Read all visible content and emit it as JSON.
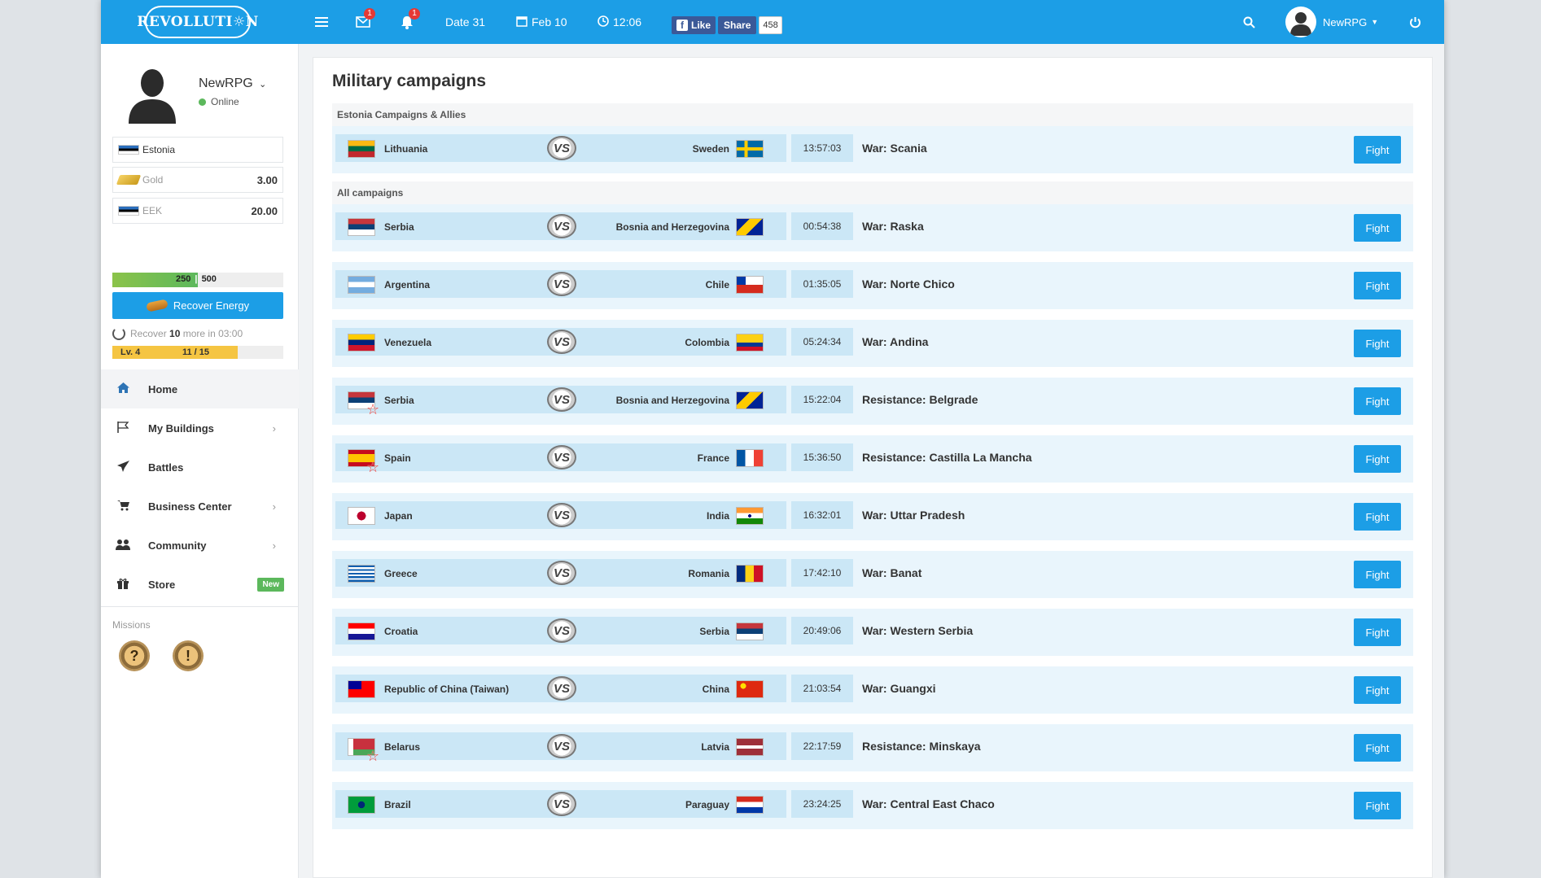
{
  "topbar": {
    "logo": "REVOLLUTI☼N",
    "mail_badge": "1",
    "notif_badge": "1",
    "date_label": "Date 31",
    "calendar_label": "Feb 10",
    "clock_label": "12:06",
    "fb_like": "Like",
    "fb_share": "Share",
    "fb_count": "458",
    "user_name": "NewRPG"
  },
  "sidebar": {
    "user_name": "NewRPG",
    "status": "Online",
    "country": "Estonia",
    "gold_label": "Gold",
    "gold_value": "3.00",
    "currency_label": "EEK",
    "currency_value": "20.00",
    "energy_current": "250",
    "energy_max": "500",
    "energy_fraction": 0.5,
    "recover_button": "Recover Energy",
    "recover_prefix": "Recover",
    "recover_amount": "10",
    "recover_suffix": "more in 03:00",
    "level_label": "Lv. 4",
    "level_progress": "11 / 15",
    "level_fraction": 0.733,
    "nav": [
      {
        "label": "Home",
        "icon": "home-icon"
      },
      {
        "label": "My Buildings",
        "icon": "flag-icon"
      },
      {
        "label": "Battles",
        "icon": "paper-plane-icon"
      },
      {
        "label": "Business Center",
        "icon": "cart-icon"
      },
      {
        "label": "Community",
        "icon": "users-icon"
      },
      {
        "label": "Store",
        "icon": "gift-icon",
        "badge": "New"
      }
    ],
    "missions_label": "Missions",
    "missions": [
      "?",
      "!"
    ]
  },
  "main": {
    "title": "Military campaigns",
    "section_allies": "Estonia Campaigns & Allies",
    "section_all": "All campaigns",
    "fight_label": "Fight",
    "vs_label": "VS",
    "allies_rows": [
      {
        "attacker": "Lithuania",
        "defender": "Sweden",
        "time": "13:57:03",
        "type": "War:",
        "region": "Scania",
        "flagA": "lt",
        "flagB": "se",
        "star": false
      }
    ],
    "rows": [
      {
        "attacker": "Serbia",
        "defender": "Bosnia and Herzegovina",
        "time": "00:54:38",
        "type": "War:",
        "region": "Raska",
        "flagA": "rs",
        "flagB": "ba",
        "star": false
      },
      {
        "attacker": "Argentina",
        "defender": "Chile",
        "time": "01:35:05",
        "type": "War:",
        "region": "Norte Chico",
        "flagA": "ar",
        "flagB": "cl",
        "star": false
      },
      {
        "attacker": "Venezuela",
        "defender": "Colombia",
        "time": "05:24:34",
        "type": "War:",
        "region": "Andina",
        "flagA": "ve",
        "flagB": "co",
        "star": false
      },
      {
        "attacker": "Serbia",
        "defender": "Bosnia and Herzegovina",
        "time": "15:22:04",
        "type": "Resistance:",
        "region": "Belgrade",
        "flagA": "rs",
        "flagB": "ba",
        "star": true
      },
      {
        "attacker": "Spain",
        "defender": "France",
        "time": "15:36:50",
        "type": "Resistance:",
        "region": "Castilla La Mancha",
        "flagA": "es",
        "flagB": "fr",
        "star": true
      },
      {
        "attacker": "Japan",
        "defender": "India",
        "time": "16:32:01",
        "type": "War:",
        "region": "Uttar Pradesh",
        "flagA": "jp",
        "flagB": "in",
        "star": false
      },
      {
        "attacker": "Greece",
        "defender": "Romania",
        "time": "17:42:10",
        "type": "War:",
        "region": "Banat",
        "flagA": "gr",
        "flagB": "ro",
        "star": false
      },
      {
        "attacker": "Croatia",
        "defender": "Serbia",
        "time": "20:49:06",
        "type": "War:",
        "region": "Western Serbia",
        "flagA": "hr",
        "flagB": "rs",
        "star": false
      },
      {
        "attacker": "Republic of China (Taiwan)",
        "defender": "China",
        "time": "21:03:54",
        "type": "War:",
        "region": "Guangxi",
        "flagA": "tw",
        "flagB": "cn",
        "star": false
      },
      {
        "attacker": "Belarus",
        "defender": "Latvia",
        "time": "22:17:59",
        "type": "Resistance:",
        "region": "Minskaya",
        "flagA": "by",
        "flagB": "lv",
        "star": true
      },
      {
        "attacker": "Brazil",
        "defender": "Paraguay",
        "time": "23:24:25",
        "type": "War:",
        "region": "Central East Chaco",
        "flagA": "br",
        "flagB": "py",
        "star": false
      }
    ]
  }
}
